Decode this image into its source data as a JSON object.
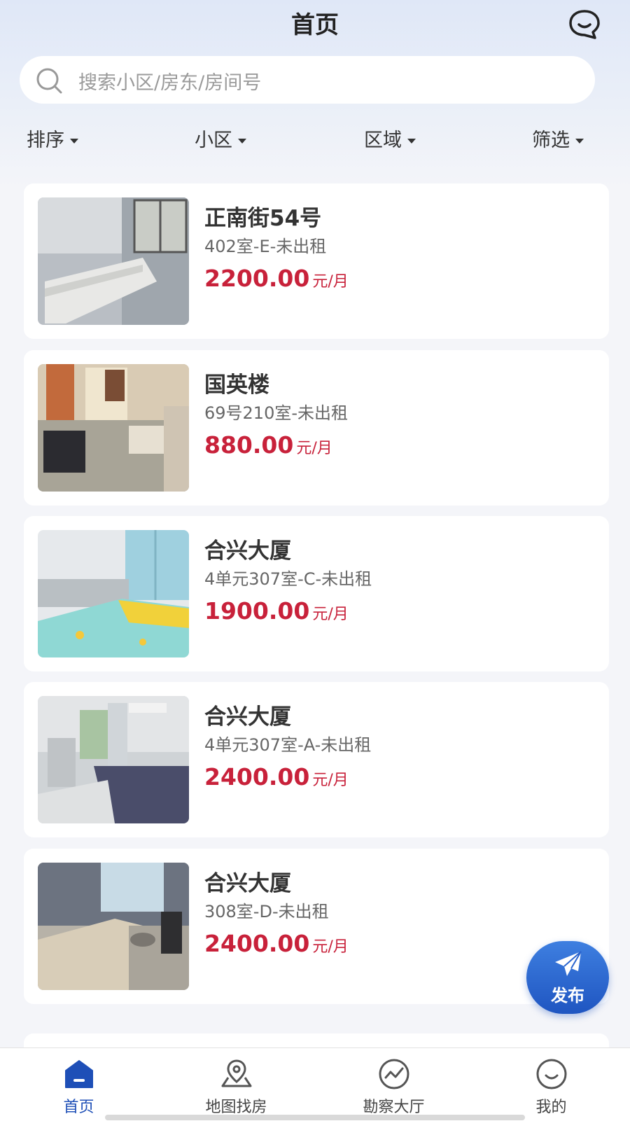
{
  "header": {
    "title": "首页",
    "message_icon": "chat-bubble-icon"
  },
  "search": {
    "placeholder": "搜索小区/房东/房间号",
    "icon": "search-icon"
  },
  "filters": [
    {
      "label": "排序"
    },
    {
      "label": "小区"
    },
    {
      "label": "区域"
    },
    {
      "label": "筛选"
    }
  ],
  "listings": [
    {
      "name": "正南街54号",
      "room": "402室-E-未出租",
      "price": "2200.00",
      "unit": "元/月"
    },
    {
      "name": "国英楼",
      "room": "69号210室-未出租",
      "price": "880.00",
      "unit": "元/月"
    },
    {
      "name": "合兴大厦",
      "room": "4单元307室-C-未出租",
      "price": "1900.00",
      "unit": "元/月"
    },
    {
      "name": "合兴大厦",
      "room": "4单元307室-A-未出租",
      "price": "2400.00",
      "unit": "元/月"
    },
    {
      "name": "合兴大厦",
      "room": "308室-D-未出租",
      "price": "2400.00",
      "unit": "元/月"
    }
  ],
  "fab": {
    "label": "发布",
    "icon": "paper-plane-icon"
  },
  "tabbar": [
    {
      "label": "首页",
      "icon": "home-icon",
      "active": true
    },
    {
      "label": "地图找房",
      "icon": "map-pin-icon",
      "active": false
    },
    {
      "label": "勘察大厅",
      "icon": "trend-icon",
      "active": false
    },
    {
      "label": "我的",
      "icon": "smile-icon",
      "active": false
    }
  ],
  "colors": {
    "accent": "#1e4fb7",
    "price": "#c8213a",
    "background": "#f4f5f9"
  }
}
